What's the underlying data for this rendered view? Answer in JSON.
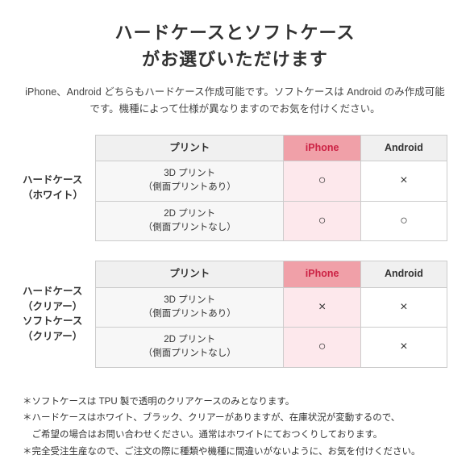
{
  "title": {
    "line1": "ハードケースとソフトケース",
    "line2": "がお選びいただけます"
  },
  "subtitle": "iPhone、Android どちらもハードケース作成可能です。ソフトケースは\nAndroid のみ作成可能です。機種によって仕様が異なりますのでお気を付けください。",
  "section1": {
    "rowLabel": "ハードケース\n（ホワイト）",
    "headers": [
      "プリント",
      "iPhone",
      "Android"
    ],
    "rows": [
      {
        "label": "3D プリント\n（側面プリントあり）",
        "iphone": "○",
        "android": "×"
      },
      {
        "label": "2D プリント\n（側面プリントなし）",
        "iphone": "○",
        "android": "○"
      }
    ]
  },
  "section2": {
    "rowLabel": "ハードケース\n（クリアー）\nソフトケース\n（クリアー）",
    "headers": [
      "プリント",
      "iPhone",
      "Android"
    ],
    "rows": [
      {
        "label": "3D プリント\n（側面プリントあり）",
        "iphone": "×",
        "android": "×"
      },
      {
        "label": "2D プリント\n（側面プリントなし）",
        "iphone": "○",
        "android": "×"
      }
    ]
  },
  "notes": [
    "＊ソフトケースは TPU 製で透明のクリアケースのみとなります。",
    "＊ハードケースはホワイト、ブラック、クリアーがありますが、在庫状況が変動するので、\n　ご希望の場合はお問い合わせください。通常はホワイトにておつくりしております。",
    "＊完全受注生産なので、ご注文の際に種類や機種に間違いがないように、お気を付けください。"
  ]
}
